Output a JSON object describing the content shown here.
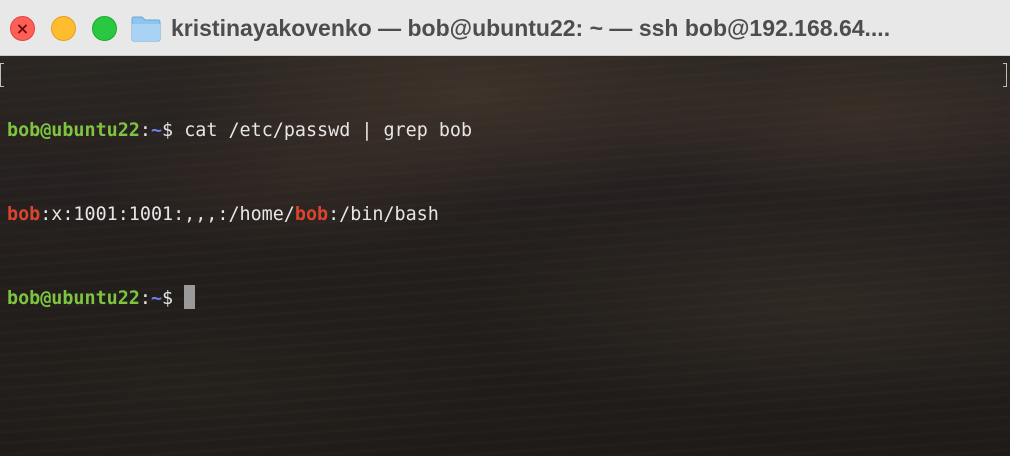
{
  "window": {
    "title": "kristinayakovenko — bob@ubuntu22: ~ — ssh bob@192.168.64....",
    "close_glyph": "×",
    "folder_icon": "folder-icon"
  },
  "colors": {
    "titlebar_bg": "#e8e8e8",
    "close": "#ff5f57",
    "minimize": "#febc2e",
    "zoom": "#28c840",
    "prompt_user": "#7ec440",
    "prompt_path": "#6c7ff0",
    "grep_match": "#d9452f",
    "text": "#e6e6e6"
  },
  "terminal": {
    "line1": {
      "user_host": "bob@ubuntu22",
      "colon": ":",
      "path": "~",
      "symbol": "$ ",
      "command": "cat /etc/passwd | grep bob"
    },
    "line2": {
      "match1": "bob",
      "mid": ":x:1001:1001:,,,:/home/",
      "match2": "bob",
      "end": ":/bin/bash"
    },
    "line3": {
      "user_host": "bob@ubuntu22",
      "colon": ":",
      "path": "~",
      "symbol": "$ "
    }
  }
}
